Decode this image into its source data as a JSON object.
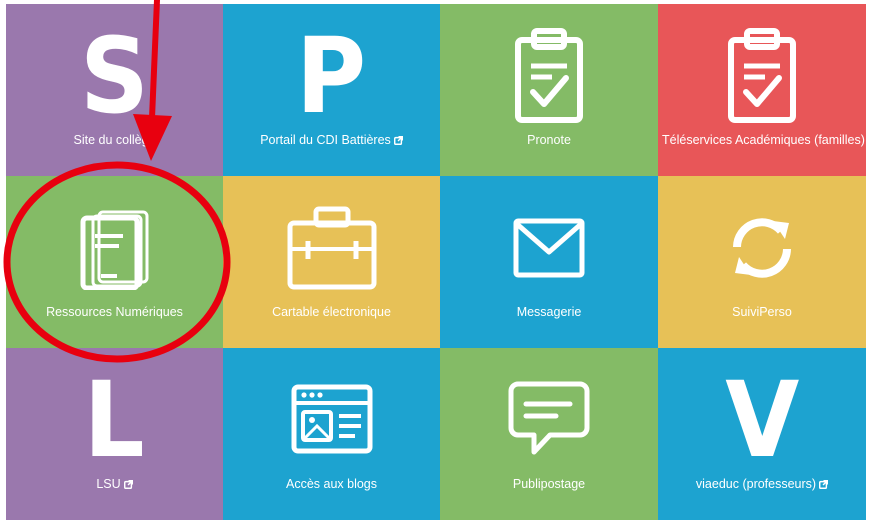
{
  "colors": {
    "purple": "#9a78ad",
    "blue": "#1da3d0",
    "green": "#84bb66",
    "red": "#e85658",
    "yellow": "#e7c157",
    "annotation": "#e8000f"
  },
  "tiles": [
    {
      "label": "Site du collège",
      "letter": "S",
      "icon": "letter-s-icon",
      "color": "purple",
      "external": false
    },
    {
      "label": "Portail du CDI Battières",
      "letter": "P",
      "icon": "letter-p-icon",
      "color": "blue",
      "external": true
    },
    {
      "label": "Pronote",
      "icon": "clipboard-check-icon",
      "color": "green",
      "external": false
    },
    {
      "label": "Téléservices Académiques (familles)",
      "icon": "clipboard-check-icon",
      "color": "red",
      "external": false
    },
    {
      "label": "Ressources Numériques",
      "icon": "book-icon",
      "color": "green",
      "external": false
    },
    {
      "label": "Cartable électronique",
      "icon": "briefcase-icon",
      "color": "yellow",
      "external": false
    },
    {
      "label": "Messagerie",
      "icon": "envelope-icon",
      "color": "blue",
      "external": false
    },
    {
      "label": "SuiviPerso",
      "icon": "sync-icon",
      "color": "yellow",
      "external": false
    },
    {
      "label": "LSU",
      "letter": "L",
      "icon": "letter-l-icon",
      "color": "purple",
      "external": true
    },
    {
      "label": "Accès aux blogs",
      "icon": "browser-window-icon",
      "color": "blue",
      "external": false
    },
    {
      "label": "Publipostage",
      "icon": "speech-bubble-icon",
      "color": "green",
      "external": false
    },
    {
      "label": "viaeduc (professeurs)",
      "letter": "V",
      "icon": "letter-v-icon",
      "color": "blue",
      "external": true
    }
  ],
  "annotation": {
    "type": "arrow-and-circle",
    "target": "Ressources Numériques"
  }
}
